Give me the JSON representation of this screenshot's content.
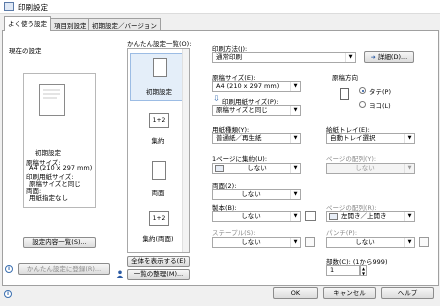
{
  "window": {
    "title": "印刷設定"
  },
  "tabs": [
    {
      "label": "よく使う設定"
    },
    {
      "label": "項目別設定"
    },
    {
      "label": "初期設定／バージョン"
    }
  ],
  "left": {
    "current_settings_label": "現在の設定",
    "preset_name": "初期設定",
    "summary_lines": [
      "原稿サイズ:",
      "A4 (210 x 297 mm)",
      "印刷用紙サイズ:",
      "原稿サイズと同じ",
      "両面:",
      "用紙指定なし"
    ],
    "details_button": "設定内容一覧(S)...",
    "register_button": "かんたん設定に登録(R)..."
  },
  "quick": {
    "label": "かんたん設定一覧(O):",
    "items": [
      {
        "label": "初期設定",
        "icon": "page-icon"
      },
      {
        "label": "集約",
        "badge": "1+2",
        "icon": "two-up-icon"
      },
      {
        "label": "両面",
        "icon": "duplex-icon"
      },
      {
        "label": "集約(両面)",
        "badge": "1+2",
        "icon": "two-up-duplex-icon"
      }
    ],
    "show_all_button": "全体を表示する(E)",
    "organize_button": "一覧の整理(M)..."
  },
  "settings": {
    "print_method_label": "印刷方法(J):",
    "print_method_value": "通常印刷",
    "details_button": "詳細(D)...",
    "paper_size_label": "原稿サイズ(E):",
    "paper_size_value": "A4 (210 x 297 mm)",
    "output_size_label": "印刷用紙サイズ(P):",
    "output_size_value": "原稿サイズと同じ",
    "orientation_label": "原稿方向",
    "orientation_portrait": "タテ(P)",
    "orientation_landscape": "ヨコ(L)",
    "paper_type_label": "用紙種類(Y):",
    "paper_type_value": "普通紙／再生紙",
    "tray_label": "給紙トレイ(E):",
    "tray_value": "自動トレイ選択",
    "nup_label": "1ページに集約(U):",
    "nup_value": "しない",
    "page_order_label": "ページの配列(Y):",
    "page_order_value": "しない",
    "duplex_label": "両面(2):",
    "duplex_value": "しない",
    "binding_label": "製本(B):",
    "binding_value": "しない",
    "page_layout_label": "ページの配列(R):",
    "page_layout_value": "左開き／上開き",
    "staple_label": "ステープル(S):",
    "staple_value": "しない",
    "punch_label": "パンチ(P):",
    "punch_value": "しない",
    "copies_label": "部数(C): (1から999)",
    "copies_value": "1"
  },
  "footer": {
    "ok": "OK",
    "cancel": "キャンセル",
    "help": "ヘルプ"
  }
}
